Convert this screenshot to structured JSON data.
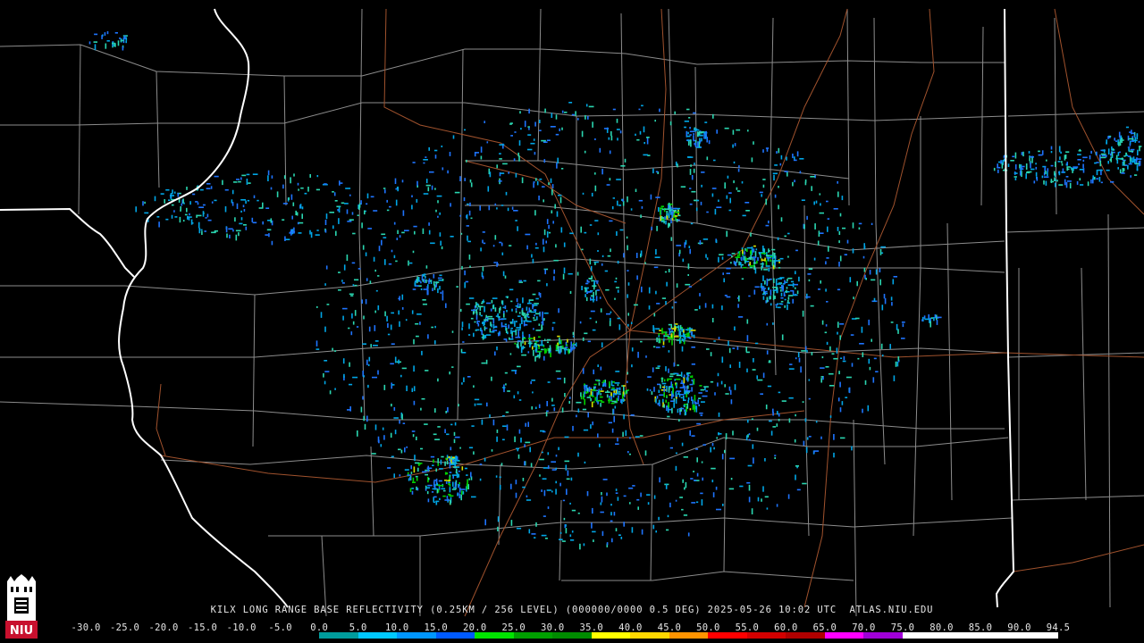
{
  "caption": {
    "product": "KILX LONG RANGE BASE REFLECTIVITY (0.25KM / 256 LEVEL) (000000/0000 0.5 DEG) 2025-05-26 10:02 UTC  ATLAS.NIU.EDU"
  },
  "logo": {
    "text": "NIU",
    "color": "#c8102e"
  },
  "legend": {
    "labels": [
      "-30.0",
      "-25.0",
      "-20.0",
      "-15.0",
      "-10.0",
      "-5.0",
      "0.0",
      "5.0",
      "10.0",
      "15.0",
      "20.0",
      "25.0",
      "30.0",
      "35.0",
      "40.0",
      "45.0",
      "50.0",
      "55.0",
      "60.0",
      "65.0",
      "70.0",
      "75.0",
      "80.0",
      "85.0",
      "90.0",
      "94.5"
    ],
    "colors": [
      "#000000",
      "#000000",
      "#000000",
      "#000000",
      "#000000",
      "#000000",
      "#009c9c",
      "#00c8ff",
      "#0096ff",
      "#005aff",
      "#00e400",
      "#00a000",
      "#008c00",
      "#ffff00",
      "#ffd800",
      "#ff9400",
      "#ff0000",
      "#d40000",
      "#b00000",
      "#ff00ff",
      "#a000d8",
      "#ffffff",
      "#ffffff",
      "#ffffff",
      "#ffffff"
    ]
  },
  "map": {
    "state_border_color": "#ffffff",
    "county_line_color": "#8c8c8c",
    "highway_color": "#a0522d",
    "echo_colors": {
      "weak": "#00a6e6",
      "light": "#1e74ff",
      "moderate": "#2ad6b0",
      "strong": "#00d000",
      "peak": "#d8e000"
    }
  }
}
